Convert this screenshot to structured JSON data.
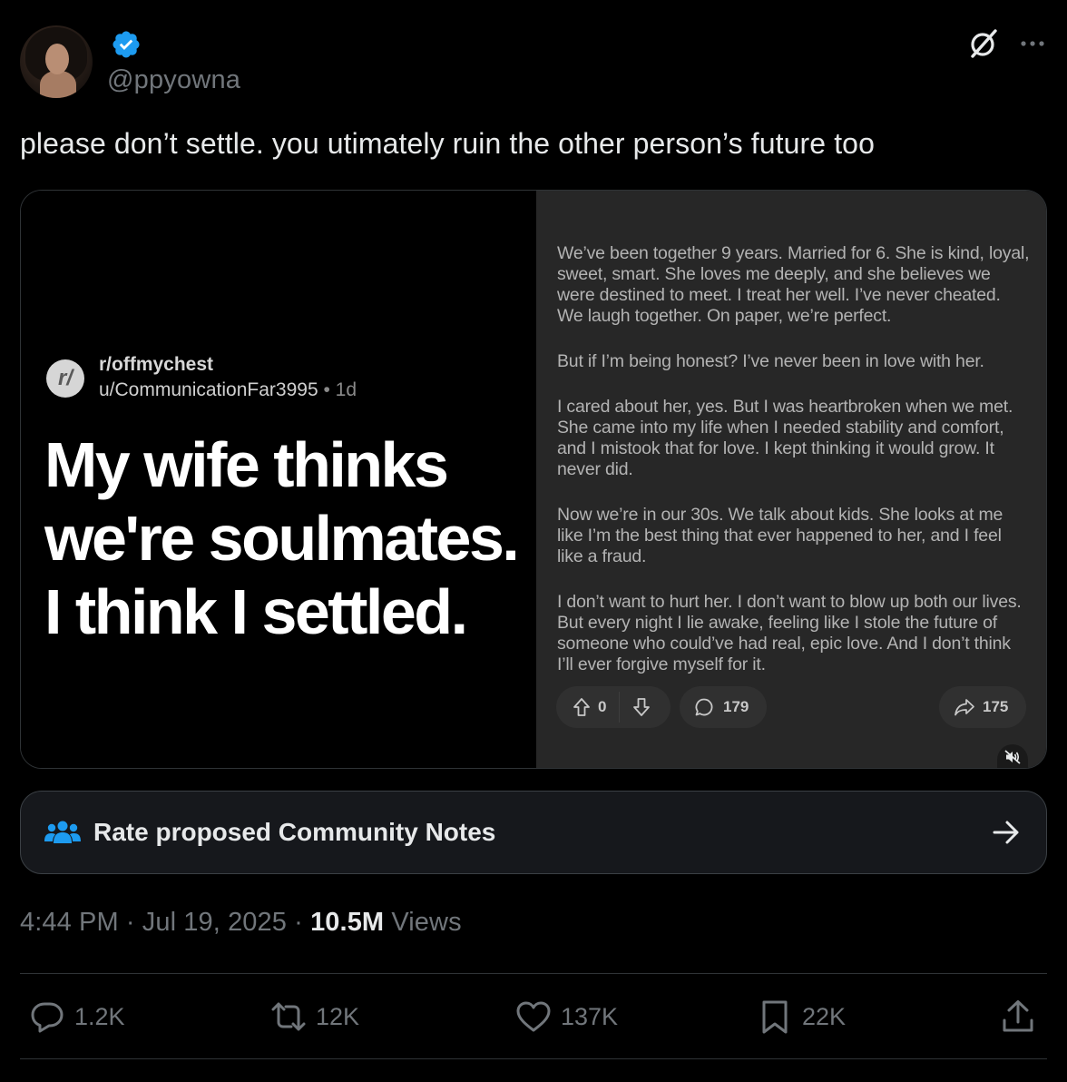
{
  "author": {
    "handle": "@ppyowna",
    "verified_icon": "verified-badge-icon",
    "verified_color": "#1d9bf0"
  },
  "tweet": {
    "text": "please don’t settle. you utimately ruin the other person’s future too"
  },
  "media": {
    "subreddit": "r/offmychest",
    "subreddit_logo": "r/",
    "username": "u/CommunicationFar3995",
    "separator": " • ",
    "age": "1d",
    "headline": "My wife thinks we're soulmates. I think I settled.",
    "paragraphs": [
      "We’ve been together 9 years. Married for 6. She is kind, loyal, sweet, smart. She loves me deeply, and she believes we were destined to meet. I treat her well. I’ve never cheated. We laugh together. On paper, we’re perfect.",
      "But if I’m being honest? I’ve never been in love with her.",
      "I cared about her, yes. But I was heartbroken when we met. She came into my life when I needed stability and comfort, and I mistook that for love. I kept thinking it would grow. It never did.",
      "Now we’re in our 30s. We talk about kids. She looks at me like I’m the best thing that ever happened to her, and I feel like a fraud.",
      "I don’t want to hurt her. I don’t want to blow up both our lives. But every night I lie awake, feeling like I stole the future of someone who could’ve had real, epic love. And I don’t think I’ll ever forgive myself for it."
    ],
    "upvotes": "0",
    "comments": "179",
    "shares": "175"
  },
  "community_notes": {
    "label": "Rate proposed Community Notes",
    "icon_color": "#1d9bf0"
  },
  "meta": {
    "time": "4:44 PM",
    "dot": " · ",
    "date": "Jul 19, 2025",
    "views_count": "10.5M",
    "views_label": " Views"
  },
  "actions": {
    "replies": "1.2K",
    "reposts": "12K",
    "likes": "137K",
    "bookmarks": "22K"
  }
}
